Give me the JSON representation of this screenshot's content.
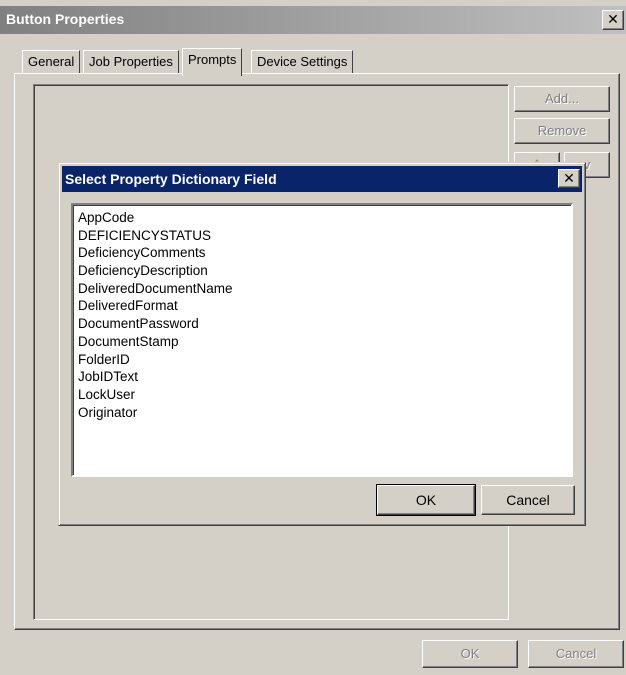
{
  "parent_window": {
    "title": "Button Properties",
    "close_glyph": "✕",
    "tabs": [
      {
        "label": "General",
        "active": false
      },
      {
        "label": "Job Properties",
        "active": false
      },
      {
        "label": "Prompts",
        "active": true
      },
      {
        "label": "Device Settings",
        "active": false
      }
    ],
    "side_buttons": {
      "add": "Add...",
      "remove": "Remove",
      "up": "^",
      "down": "v"
    },
    "ok_label": "OK",
    "cancel_label": "Cancel"
  },
  "dialog": {
    "title": "Select Property Dictionary Field",
    "close_glyph": "✕",
    "fields": [
      "AppCode",
      "DEFICIENCYSTATUS",
      "DeficiencyComments",
      "DeficiencyDescription",
      "DeliveredDocumentName",
      "DeliveredFormat",
      "DocumentPassword",
      "DocumentStamp",
      "FolderID",
      "JobIDText",
      "LockUser",
      "Originator"
    ],
    "ok_label": "OK",
    "cancel_label": "Cancel"
  },
  "colors": {
    "dialog_face": "#d4d0c8",
    "active_titlebar": "#0a246a",
    "inactive_titlebar": "#808080"
  }
}
